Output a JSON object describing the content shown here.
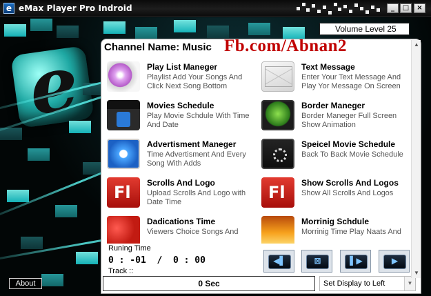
{
  "window": {
    "title": "eMax Player Pro Indroid",
    "icon_letter": "e"
  },
  "volume": {
    "text": "Volume Level  25"
  },
  "channel": {
    "label": "Channel Name: Music"
  },
  "overlay_text": "Fb.com/Abnan2",
  "items": [
    {
      "name": "Play List Maneger",
      "desc": "Playlist Add Your Songs And Click Next Song Bottom",
      "icon": "playlist-disc-icon"
    },
    {
      "name": "Text Message",
      "desc": "Enter Your Text Message And Play Yor Message On Screen",
      "icon": "envelope-icon"
    },
    {
      "name": "Movies Schedule",
      "desc": "Play Movie Schdule With Time And Date",
      "icon": "clapperboard-icon"
    },
    {
      "name": "Border Maneger",
      "desc": "Border Maneger Full Screen Show Animation",
      "icon": "clover-display-icon"
    },
    {
      "name": "Advertisment Maneger",
      "desc": "Time Advertisment And Every Song With Adds",
      "icon": "compass-icon"
    },
    {
      "name": "Speicel Movie Schedule",
      "desc": "Back To Back Movie Schedule",
      "icon": "loading-player-icon"
    },
    {
      "name": "Scrolls And Logo",
      "desc": "Upload Scrolls And Logo with Date Time",
      "icon": "flash-icon"
    },
    {
      "name": "Show Scrolls And Logos",
      "desc": "Show All Scrolls And Logos",
      "icon": "flash-icon"
    },
    {
      "name": "Dadications Time",
      "desc": "Viewers Choice Songs And",
      "icon": "heart-icon"
    },
    {
      "name": "Morrinig Schdule",
      "desc": "Morrinig Time Play Naats And",
      "icon": "sunset-icon"
    }
  ],
  "player": {
    "runing_label": "Runing Time",
    "time_elapsed": "0 : -01",
    "time_sep": "/",
    "time_total": "0 : 00",
    "track_label": "Track ::"
  },
  "controls": [
    {
      "name": "previous-button",
      "glyph": "◀▌"
    },
    {
      "name": "stop-button",
      "glyph": "⊠"
    },
    {
      "name": "next-button",
      "glyph": "▌▶"
    },
    {
      "name": "play-button",
      "glyph": "▶"
    }
  ],
  "status": {
    "text": "0  Sec"
  },
  "display_select": {
    "value": "Set Display to Left",
    "arrow": "▼"
  },
  "about_button": {
    "label": "About"
  },
  "window_buttons": {
    "minimize": "_",
    "maximize": "□",
    "close": "×"
  },
  "scroll_glyphs": {
    "up": "▲",
    "down": "▼"
  }
}
